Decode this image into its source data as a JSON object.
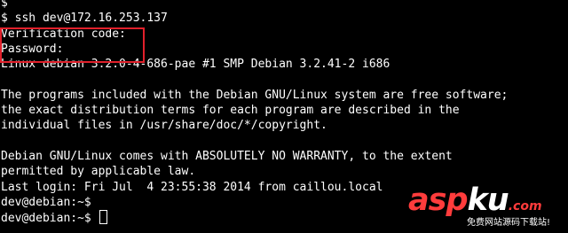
{
  "terminal": {
    "lines": [
      "$",
      "$ ssh dev@172.16.253.137",
      "Verification code:",
      "Password:",
      "Linux debian 3.2.0-4-686-pae #1 SMP Debian 3.2.41-2 i686",
      "",
      "The programs included with the Debian GNU/Linux system are free software;",
      "the exact distribution terms for each program are described in the",
      "individual files in /usr/share/doc/*/copyright.",
      "",
      "Debian GNU/Linux comes with ABSOLUTELY NO WARRANTY, to the extent",
      "permitted by applicable law.",
      "Last login: Fri Jul  4 23:55:38 2014 from caillou.local",
      "dev@debian:~$",
      "dev@debian:~$ "
    ],
    "background_color": "#000000",
    "text_color": "#ffffff",
    "highlight_color": "#e1202b"
  },
  "watermark": {
    "logo_asp": "asp",
    "logo_ku": "ku",
    "logo_com": ".com",
    "tagline": "免费网站源码下载站!",
    "accent_color": "#ff3c3c"
  }
}
